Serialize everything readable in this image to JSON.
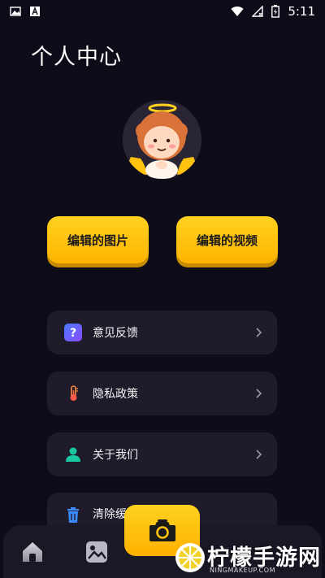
{
  "status_bar": {
    "time": "5:11",
    "icons": [
      "image-icon",
      "font-icon",
      "wifi-icon",
      "signal-icon",
      "battery-charging-icon"
    ]
  },
  "page": {
    "title": "个人中心"
  },
  "actions": {
    "edit_pictures": "编辑的图片",
    "edit_videos": "编辑的视频"
  },
  "menu": [
    {
      "label": "意见反馈",
      "icon": "question-icon"
    },
    {
      "label": "隐私政策",
      "icon": "thermometer-icon"
    },
    {
      "label": "关于我们",
      "icon": "person-icon"
    },
    {
      "label": "清除缓",
      "icon": "trash-icon"
    }
  ],
  "bottom_nav": {
    "items": [
      "home-icon",
      "gallery-icon",
      "camera-icon"
    ]
  },
  "watermark": {
    "text": "柠檬手游网",
    "sub": "NINGMAKEUP.COM"
  },
  "colors": {
    "background": "#0f0c1a",
    "card": "#1f1b2a",
    "accent": "#ffc20e"
  }
}
